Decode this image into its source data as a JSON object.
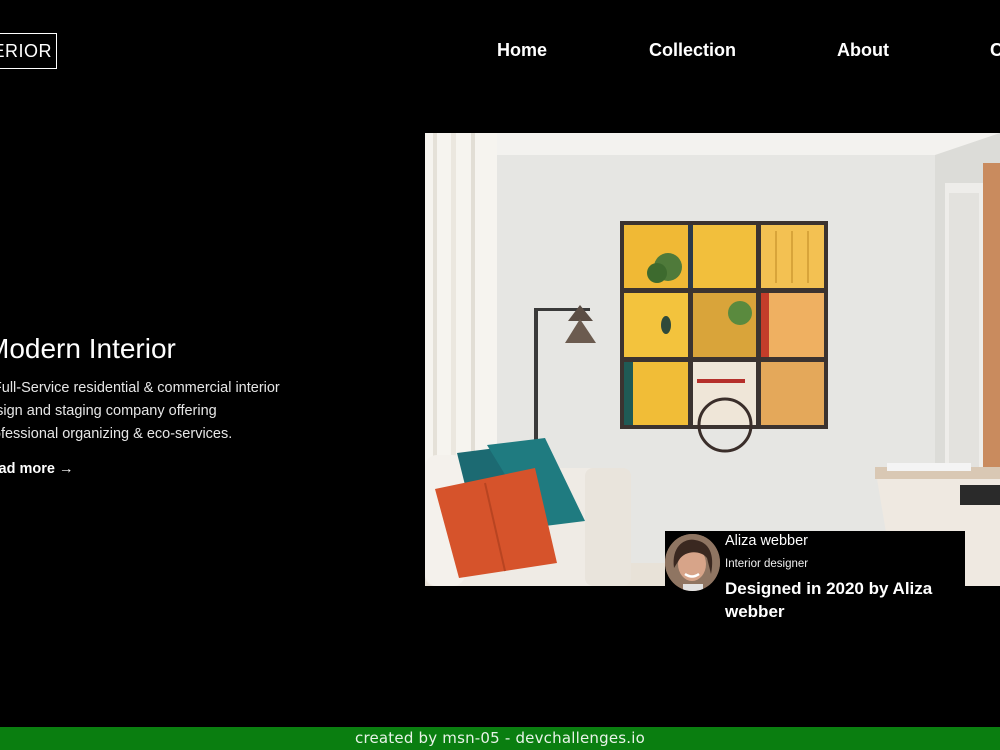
{
  "header": {
    "logo_text": "INTERIOR",
    "nav": [
      {
        "label": "Home"
      },
      {
        "label": "Collection"
      },
      {
        "label": "About"
      },
      {
        "label": "Contact"
      }
    ]
  },
  "hero": {
    "title": "Modern Interior",
    "description": "A Full-Service residential & commercial interior design and staging company offering professional organizing & eco-services.",
    "read_more_label": "Read more",
    "read_more_arrow": "→"
  },
  "designer_card": {
    "name": "Aliza webber",
    "role": "Interior designer",
    "caption": "Designed in 2020 by Aliza webber"
  },
  "footer": {
    "text": "created by msn-05 - devchallenges.io"
  },
  "colors": {
    "background": "#000000",
    "text": "#ffffff",
    "footer_bg": "#0a7e10"
  }
}
